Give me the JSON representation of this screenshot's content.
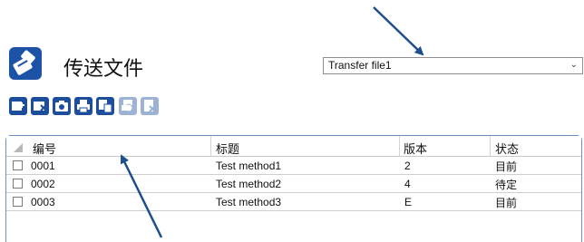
{
  "header": {
    "app_icon": "transfer-app-icon",
    "title": "传送文件",
    "file_select": {
      "value": "Transfer file1",
      "icon": "chevron-down-icon"
    }
  },
  "toolbar": {
    "buttons": [
      {
        "icon": "add-icon",
        "enabled": true
      },
      {
        "icon": "remove-icon",
        "enabled": true
      },
      {
        "icon": "camera-icon",
        "enabled": true
      },
      {
        "icon": "print-icon",
        "enabled": true
      },
      {
        "icon": "copy-icon",
        "enabled": true
      },
      {
        "icon": "print-preview-icon",
        "enabled": false
      },
      {
        "icon": "delete-icon",
        "enabled": false
      }
    ]
  },
  "table": {
    "columns": [
      "编号",
      "标题",
      "版本",
      "状态"
    ],
    "rows": [
      {
        "id": "0001",
        "title": "Test method1",
        "version": "2",
        "status": "目前"
      },
      {
        "id": "0002",
        "title": "Test method2",
        "version": "4",
        "status": "待定"
      },
      {
        "id": "0003",
        "title": "Test method3",
        "version": "E",
        "status": "目前"
      }
    ]
  },
  "colors": {
    "accent": "#1c4e9c",
    "arrow": "#1f4e8c",
    "grid_border": "#6e8fc2"
  }
}
